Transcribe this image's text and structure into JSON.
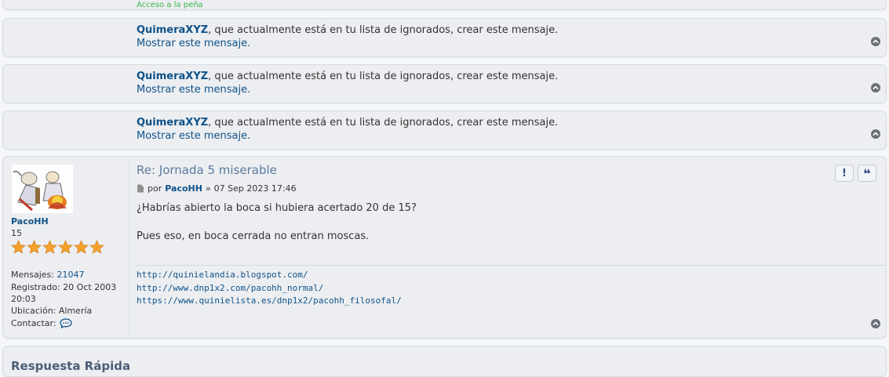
{
  "partial_top": {
    "text": "Acceso a la peña"
  },
  "ignored_posts": [
    {
      "user": "QuimeraXYZ",
      "message": ", que actualmente está en tu lista de ignorados, crear este mensaje.",
      "show_label": "Mostrar este mensaje."
    },
    {
      "user": "QuimeraXYZ",
      "message": ", que actualmente está en tu lista de ignorados, crear este mensaje.",
      "show_label": "Mostrar este mensaje."
    },
    {
      "user": "QuimeraXYZ",
      "message": ", que actualmente está en tu lista de ignorados, crear este mensaje.",
      "show_label": "Mostrar este mensaje."
    }
  ],
  "post": {
    "title": "Re: Jornada 5 miserable",
    "by_label": "por",
    "author": "PacoHH",
    "separator": "»",
    "date": "07 Sep 2023 17:46",
    "body_line1": "¿Habrías abierto la boca si hubiera acertado 20 de 15?",
    "body_line2": "Pues eso, en boca cerrada no entran moscas.",
    "signature": [
      "http://quinielandia.blogspot.com/",
      "http://www.dnp1x2.com/pacohh_normal/",
      "https://www.quinielista.es/dnp1x2/pacohh_filosofal/"
    ],
    "report_label": "!",
    "quote_label": "❝"
  },
  "profile": {
    "name": "PacoHH",
    "rank": "15",
    "stars": 6,
    "posts_label": "Mensajes:",
    "posts_value": "21047",
    "registered_label": "Registrado:",
    "registered_value": "20 Oct 2003",
    "registered_time": "20:03",
    "location_label": "Ubicación:",
    "location_value": "Almería",
    "contact_label": "Contactar:"
  },
  "quick_reply": {
    "title": "Respuesta Rápida"
  },
  "colors": {
    "link": "#105289",
    "star": "#f4a12b",
    "panel": "#eceef1"
  }
}
